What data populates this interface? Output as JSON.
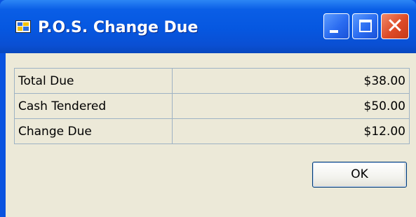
{
  "window": {
    "title": "P.O.S. Change Due"
  },
  "titlebar_buttons": {
    "minimize_icon": "minimize-icon",
    "maximize_icon": "maximize-icon",
    "close_icon": "close-icon",
    "close_glyph": "✕"
  },
  "rows": [
    {
      "label": "Total Due",
      "value": "$38.00"
    },
    {
      "label": "Cash Tendered",
      "value": "$50.00"
    },
    {
      "label": "Change Due",
      "value": "$12.00"
    }
  ],
  "ok_button": {
    "label": "OK"
  },
  "colors": {
    "titlebar": "#0657e0",
    "client_bg": "#ece9d8",
    "close_button": "#dd4a26"
  }
}
